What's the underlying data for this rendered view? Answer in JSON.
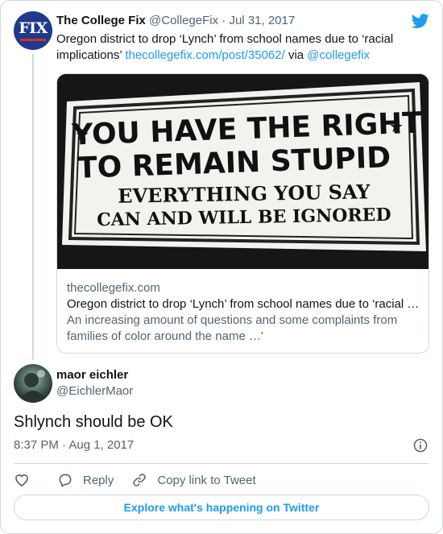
{
  "parent_tweet": {
    "author_name": "The College Fix",
    "author_handle": "@CollegeFix",
    "separator": "·",
    "date": "Jul 31, 2017",
    "avatar_text": "FIX",
    "text_before": "Oregon district to drop ‘Lynch’ from school names due to ‘racial implications’ ",
    "link_text": "thecollegefix.com/post/35062/",
    "text_via": " via ",
    "mention": "@collegefix",
    "card": {
      "image_lines": [
        "YOU HAVE THE RIGHT",
        "TO REMAIN STUPID",
        "EVERYTHING YOU SAY",
        "CAN AND WILL BE IGNORED"
      ],
      "domain": "thecollegefix.com",
      "title": "Oregon district to drop ‘Lynch’ from school names due to ‘racial …",
      "description": "An increasing amount of questions and some complaints from families of color around the name …'"
    }
  },
  "tweet": {
    "author_name": "maor eichler",
    "author_handle": "@EichlerMaor",
    "text": "Shlynch should be OK",
    "time": "8:37 PM · Aug 1, 2017"
  },
  "actions": {
    "like_icon": "heart-icon",
    "reply_label": "Reply",
    "copy_label": "Copy link to Tweet"
  },
  "explore_label": "Explore what's happening on Twitter",
  "colors": {
    "accent": "#1d9bf0",
    "text": "#0f1419",
    "secondary": "#536471",
    "border": "#cfd9de"
  }
}
